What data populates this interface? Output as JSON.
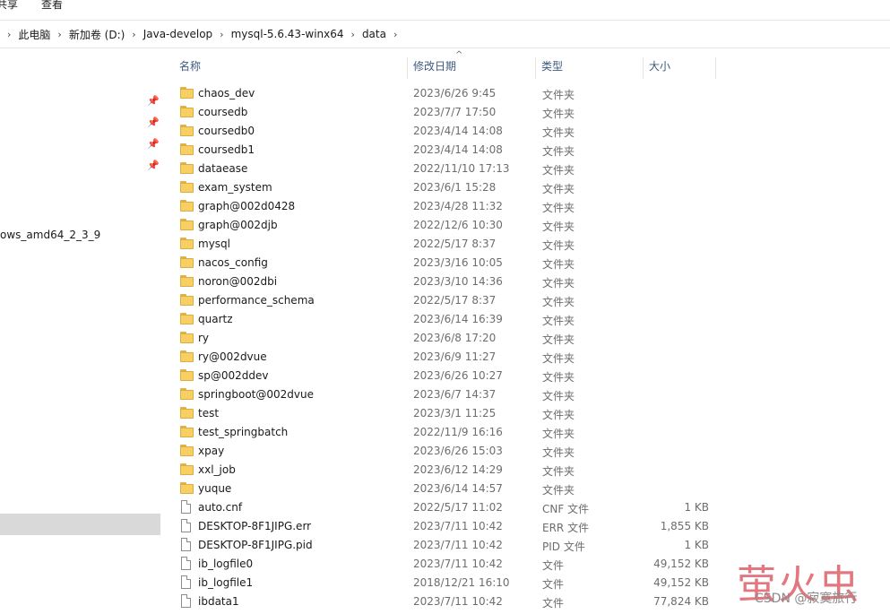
{
  "ribbon": {
    "tab_share": "共享",
    "tab_view": "查看"
  },
  "breadcrumbs": [
    "此电脑",
    "新加卷 (D:)",
    "Java-develop",
    "mysql-5.6.43-winx64",
    "data"
  ],
  "nav": {
    "pin_icons": [
      "pin-icon",
      "pin-icon",
      "pin-icon",
      "pin-icon"
    ],
    "partial_item": "ows_amd64_2_3_9"
  },
  "columns": {
    "name": "名称",
    "modified": "修改日期",
    "type": "类型",
    "size": "大小"
  },
  "files": [
    {
      "name": "chaos_dev",
      "date": "2023/6/26 9:45",
      "type": "文件夹",
      "size": "",
      "kind": "folder"
    },
    {
      "name": "coursedb",
      "date": "2023/7/7 17:50",
      "type": "文件夹",
      "size": "",
      "kind": "folder"
    },
    {
      "name": "coursedb0",
      "date": "2023/4/14 14:08",
      "type": "文件夹",
      "size": "",
      "kind": "folder"
    },
    {
      "name": "coursedb1",
      "date": "2023/4/14 14:08",
      "type": "文件夹",
      "size": "",
      "kind": "folder"
    },
    {
      "name": "dataease",
      "date": "2022/11/10 17:13",
      "type": "文件夹",
      "size": "",
      "kind": "folder"
    },
    {
      "name": "exam_system",
      "date": "2023/6/1 15:28",
      "type": "文件夹",
      "size": "",
      "kind": "folder"
    },
    {
      "name": "graph@002d0428",
      "date": "2023/4/28 11:32",
      "type": "文件夹",
      "size": "",
      "kind": "folder"
    },
    {
      "name": "graph@002djb",
      "date": "2022/12/6 10:30",
      "type": "文件夹",
      "size": "",
      "kind": "folder"
    },
    {
      "name": "mysql",
      "date": "2022/5/17 8:37",
      "type": "文件夹",
      "size": "",
      "kind": "folder"
    },
    {
      "name": "nacos_config",
      "date": "2023/3/16 10:05",
      "type": "文件夹",
      "size": "",
      "kind": "folder"
    },
    {
      "name": "noron@002dbi",
      "date": "2023/3/10 14:36",
      "type": "文件夹",
      "size": "",
      "kind": "folder"
    },
    {
      "name": "performance_schema",
      "date": "2022/5/17 8:37",
      "type": "文件夹",
      "size": "",
      "kind": "folder"
    },
    {
      "name": "quartz",
      "date": "2023/6/14 16:39",
      "type": "文件夹",
      "size": "",
      "kind": "folder"
    },
    {
      "name": "ry",
      "date": "2023/6/8 17:20",
      "type": "文件夹",
      "size": "",
      "kind": "folder"
    },
    {
      "name": "ry@002dvue",
      "date": "2023/6/9 11:27",
      "type": "文件夹",
      "size": "",
      "kind": "folder"
    },
    {
      "name": "sp@002ddev",
      "date": "2023/6/26 10:27",
      "type": "文件夹",
      "size": "",
      "kind": "folder"
    },
    {
      "name": "springboot@002dvue",
      "date": "2023/6/7 14:37",
      "type": "文件夹",
      "size": "",
      "kind": "folder"
    },
    {
      "name": "test",
      "date": "2023/3/1 11:25",
      "type": "文件夹",
      "size": "",
      "kind": "folder"
    },
    {
      "name": "test_springbatch",
      "date": "2022/11/9 16:16",
      "type": "文件夹",
      "size": "",
      "kind": "folder"
    },
    {
      "name": "xpay",
      "date": "2023/6/26 15:03",
      "type": "文件夹",
      "size": "",
      "kind": "folder"
    },
    {
      "name": "xxl_job",
      "date": "2023/6/12 14:29",
      "type": "文件夹",
      "size": "",
      "kind": "folder"
    },
    {
      "name": "yuque",
      "date": "2023/6/14 14:57",
      "type": "文件夹",
      "size": "",
      "kind": "folder"
    },
    {
      "name": "auto.cnf",
      "date": "2022/5/17 11:02",
      "type": "CNF 文件",
      "size": "1 KB",
      "kind": "file"
    },
    {
      "name": "DESKTOP-8F1JIPG.err",
      "date": "2023/7/11 10:42",
      "type": "ERR 文件",
      "size": "1,855 KB",
      "kind": "file"
    },
    {
      "name": "DESKTOP-8F1JIPG.pid",
      "date": "2023/7/11 10:42",
      "type": "PID 文件",
      "size": "1 KB",
      "kind": "file"
    },
    {
      "name": "ib_logfile0",
      "date": "2023/7/11 10:42",
      "type": "文件",
      "size": "49,152 KB",
      "kind": "file"
    },
    {
      "name": "ib_logfile1",
      "date": "2018/12/21 16:10",
      "type": "文件",
      "size": "49,152 KB",
      "kind": "file"
    },
    {
      "name": "ibdata1",
      "date": "2023/7/11 10:42",
      "type": "文件",
      "size": "77,824 KB",
      "kind": "file"
    }
  ],
  "watermark": {
    "big": "萤火虫",
    "small": "CSDN @寂寞旅行"
  },
  "colors": {
    "folder": "#f7cf63",
    "header_text": "#3d5a80",
    "selection": "#d9d9d9",
    "watermark": "#d94a55"
  }
}
